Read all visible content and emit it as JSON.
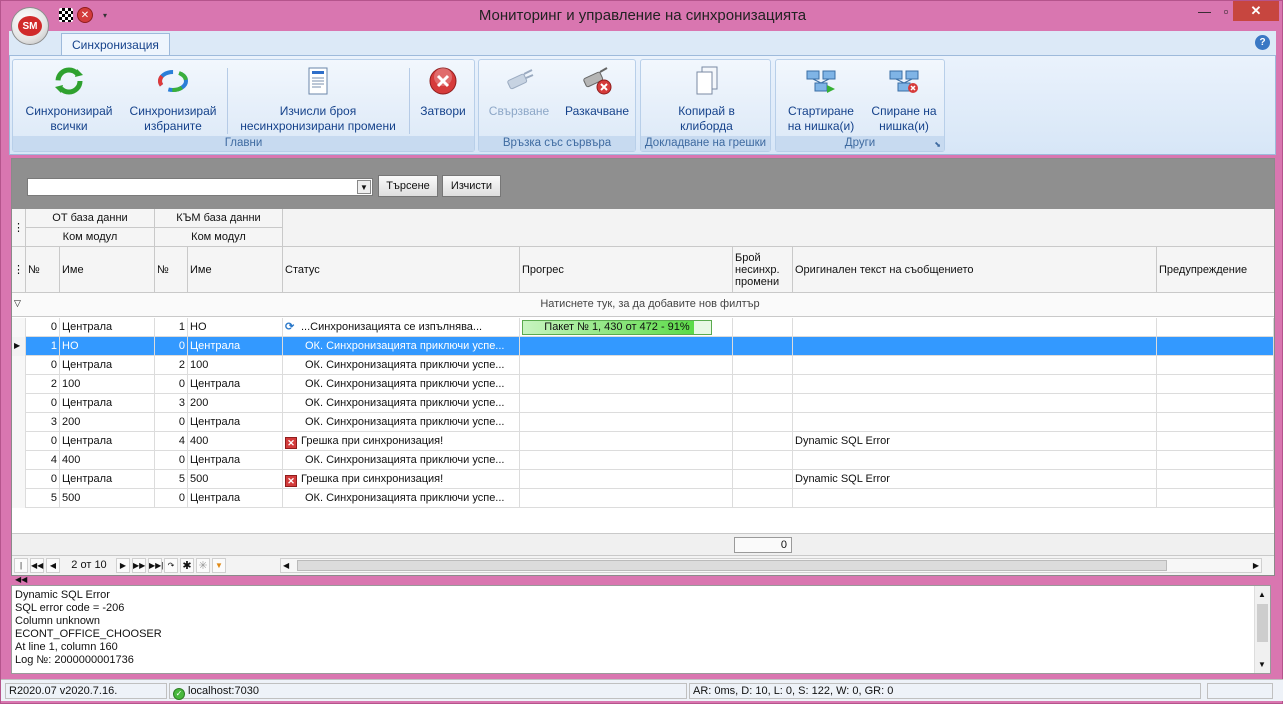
{
  "window": {
    "title": "Мониторинг и управление на синхронизацията",
    "app_badge": "SM"
  },
  "ribbon": {
    "tab": "Синхронизация",
    "groups": {
      "main": "Главни",
      "server": "Връзка със сървъра",
      "errors": "Докладване на грешки",
      "other": "Други"
    },
    "buttons": {
      "sync_all_1": "Синхронизирай",
      "sync_all_2": "всички",
      "sync_sel_1": "Синхронизирай",
      "sync_sel_2": "избраните",
      "calc_1": "Изчисли броя",
      "calc_2": "несинхронизирани промени",
      "close": "Затвори",
      "connect": "Свързване",
      "disconnect": "Разкачване",
      "copy_1": "Копирай в",
      "copy_2": "клиборда",
      "start_1": "Стартиране",
      "start_2": "на нишка(и)",
      "stop_1": "Спиране на",
      "stop_2": "нишка(и)"
    }
  },
  "search": {
    "value": "",
    "search_label": "Търсене",
    "clear_label": "Изчисти"
  },
  "grid": {
    "band_from": "ОТ база данни",
    "band_to": "КЪМ база данни",
    "band_from_sub": "Ком модул",
    "band_to_sub": "Ком модул",
    "columns": {
      "num_from": "№",
      "name_from": "Име",
      "num_to": "№",
      "name_to": "Име",
      "status": "Статус",
      "progress": "Прогрес",
      "count_1": "Брой",
      "count_2": "несинхр.",
      "count_3": "промени",
      "orig_text": "Оригинален текст на съобщението",
      "warning": "Предупреждение"
    },
    "filter_hint": "Натиснете тук, за да добавите нов филтър",
    "rows": [
      {
        "num_from": "0",
        "name_from": "Централа",
        "num_to": "1",
        "name_to": "НО",
        "status": "...Синхронизацията се изпълнява...",
        "status_type": "running",
        "progress": "Пакет № 1, 430 от 472 - 91%",
        "progress_pct": 91,
        "orig": ""
      },
      {
        "num_from": "1",
        "name_from": "НО",
        "num_to": "0",
        "name_to": "Централа",
        "status": "ОК. Синхронизацията приключи успе...",
        "status_type": "ok",
        "progress": "",
        "orig": "",
        "selected": true
      },
      {
        "num_from": "0",
        "name_from": "Централа",
        "num_to": "2",
        "name_to": "100",
        "status": "ОК. Синхронизацията приключи успе...",
        "status_type": "ok",
        "progress": "",
        "orig": ""
      },
      {
        "num_from": "2",
        "name_from": "100",
        "num_to": "0",
        "name_to": "Централа",
        "status": "ОК. Синхронизацията приключи успе...",
        "status_type": "ok",
        "progress": "",
        "orig": ""
      },
      {
        "num_from": "0",
        "name_from": "Централа",
        "num_to": "3",
        "name_to": "200",
        "status": "ОК. Синхронизацията приключи успе...",
        "status_type": "ok",
        "progress": "",
        "orig": ""
      },
      {
        "num_from": "3",
        "name_from": "200",
        "num_to": "0",
        "name_to": "Централа",
        "status": "ОК. Синхронизацията приключи успе...",
        "status_type": "ok",
        "progress": "",
        "orig": ""
      },
      {
        "num_from": "0",
        "name_from": "Централа",
        "num_to": "4",
        "name_to": "400",
        "status": "Грешка при синхронизация!",
        "status_type": "error",
        "progress": "",
        "orig": "Dynamic SQL Error"
      },
      {
        "num_from": "4",
        "name_from": "400",
        "num_to": "0",
        "name_to": "Централа",
        "status": "ОК. Синхронизацията приключи успе...",
        "status_type": "ok",
        "progress": "",
        "orig": ""
      },
      {
        "num_from": "0",
        "name_from": "Централа",
        "num_to": "5",
        "name_to": "500",
        "status": "Грешка при синхронизация!",
        "status_type": "error",
        "progress": "",
        "orig": "Dynamic SQL Error"
      },
      {
        "num_from": "5",
        "name_from": "500",
        "num_to": "0",
        "name_to": "Централа",
        "status": "ОК. Синхронизацията приключи успе...",
        "status_type": "ok",
        "progress": "",
        "orig": ""
      }
    ],
    "footer_total": "0",
    "pager": "2 от 10"
  },
  "message": {
    "lines": [
      "Dynamic SQL Error",
      "SQL error code = -206",
      "Column unknown",
      "ECONT_OFFICE_CHOOSER",
      "At line 1, column 160",
      "Log №: 2000000001736"
    ]
  },
  "status": {
    "version": "R2020.07 v2020.7.16.",
    "server": "localhost:7030",
    "stats": "AR: 0ms, D: 10, L: 0, S: 122, W: 0, GR: 0"
  },
  "colors": {
    "selection": "#3399ff",
    "progress": "#5bdb47",
    "error": "#d33b3b",
    "titlebar": "#d976b0"
  }
}
